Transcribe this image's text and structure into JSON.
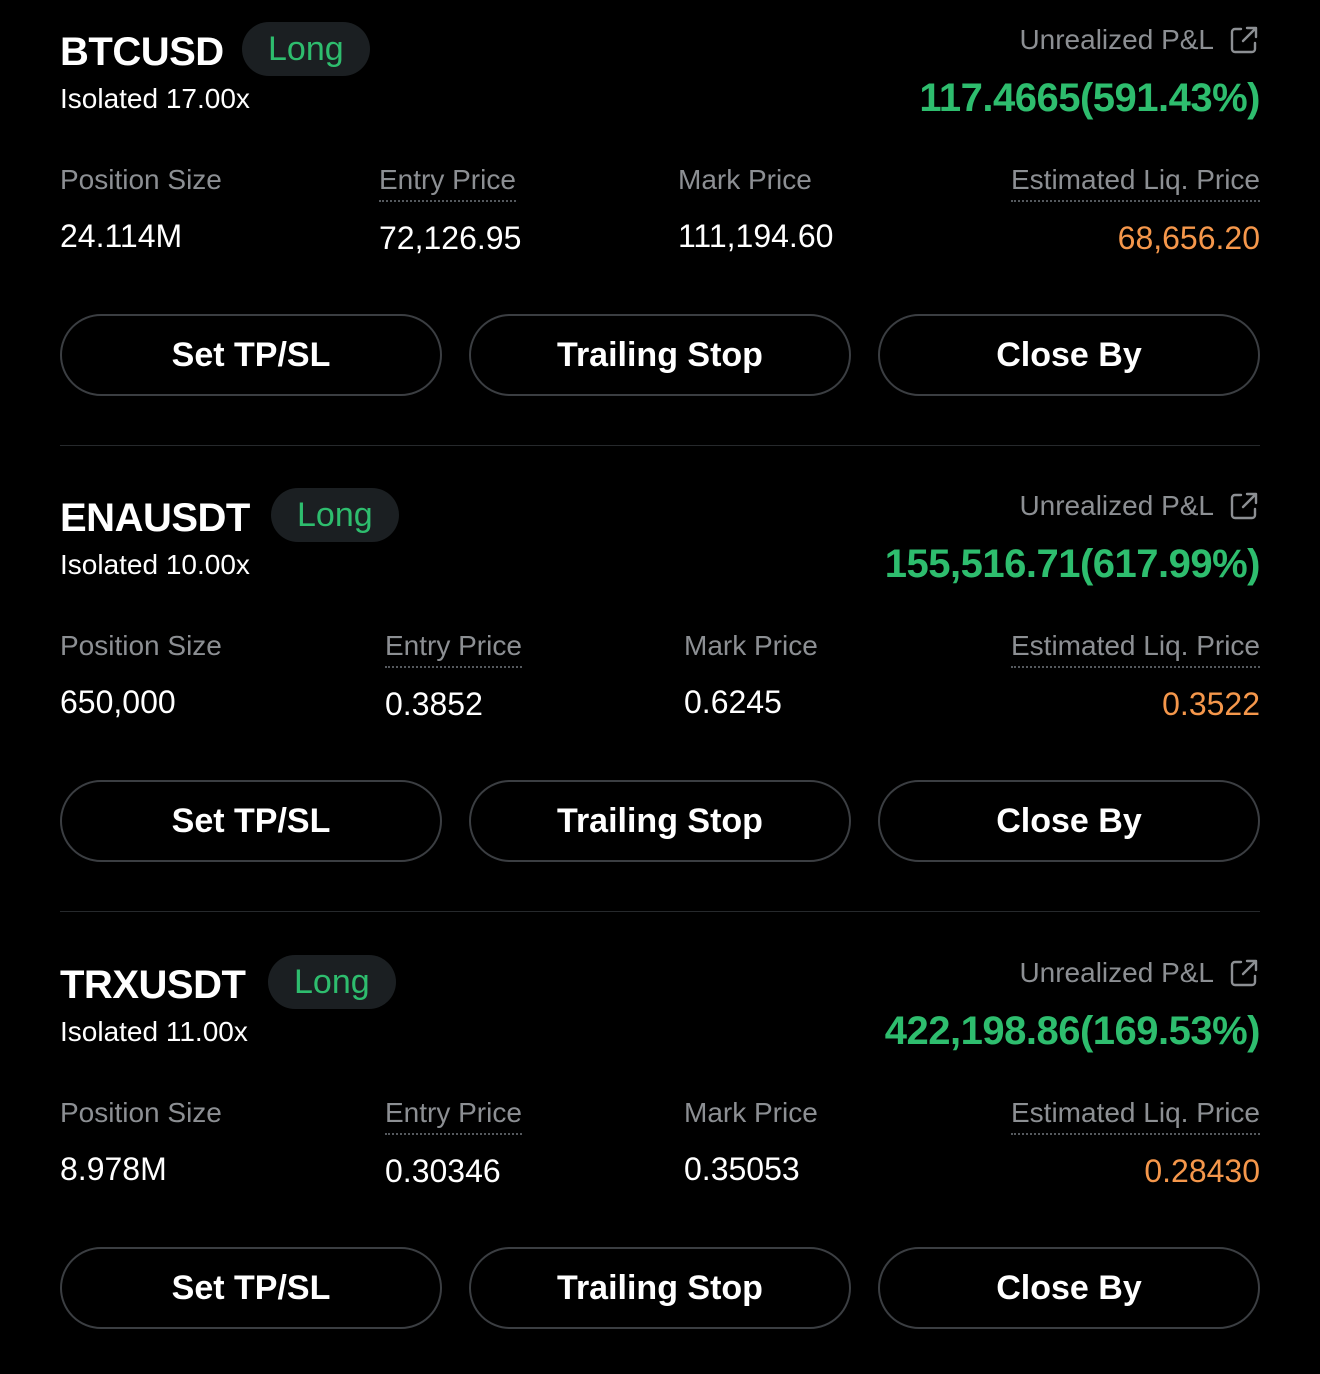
{
  "labels": {
    "unrealized_pnl": "Unrealized P&L",
    "position_size": "Position Size",
    "entry_price": "Entry Price",
    "mark_price": "Mark Price",
    "liq_price": "Estimated Liq. Price"
  },
  "buttons": {
    "tpsl": "Set TP/SL",
    "trailing_stop": "Trailing Stop",
    "close_by": "Close By"
  },
  "colors": {
    "background": "#000000",
    "profit_green": "#2ebd6e",
    "liq_orange": "#f5974b",
    "muted_text": "#8c8f93",
    "badge_bg": "#1b1f22"
  },
  "icons": {
    "pnl_share": "external-link-icon"
  },
  "positions": [
    {
      "symbol": "BTCUSD",
      "side": "Long",
      "margin_mode": "Isolated 17.00x",
      "unrealized_pnl": "117.4665(591.43%)",
      "position_size": "24.114M",
      "entry_price": "72,126.95",
      "mark_price": "111,194.60",
      "liq_price": "68,656.20"
    },
    {
      "symbol": "ENAUSDT",
      "side": "Long",
      "margin_mode": "Isolated 10.00x",
      "unrealized_pnl": "155,516.71(617.99%)",
      "position_size": "650,000",
      "entry_price": "0.3852",
      "mark_price": "0.6245",
      "liq_price": "0.3522"
    },
    {
      "symbol": "TRXUSDT",
      "side": "Long",
      "margin_mode": "Isolated 11.00x",
      "unrealized_pnl": "422,198.86(169.53%)",
      "position_size": "8.978M",
      "entry_price": "0.30346",
      "mark_price": "0.35053",
      "liq_price": "0.28430"
    }
  ]
}
